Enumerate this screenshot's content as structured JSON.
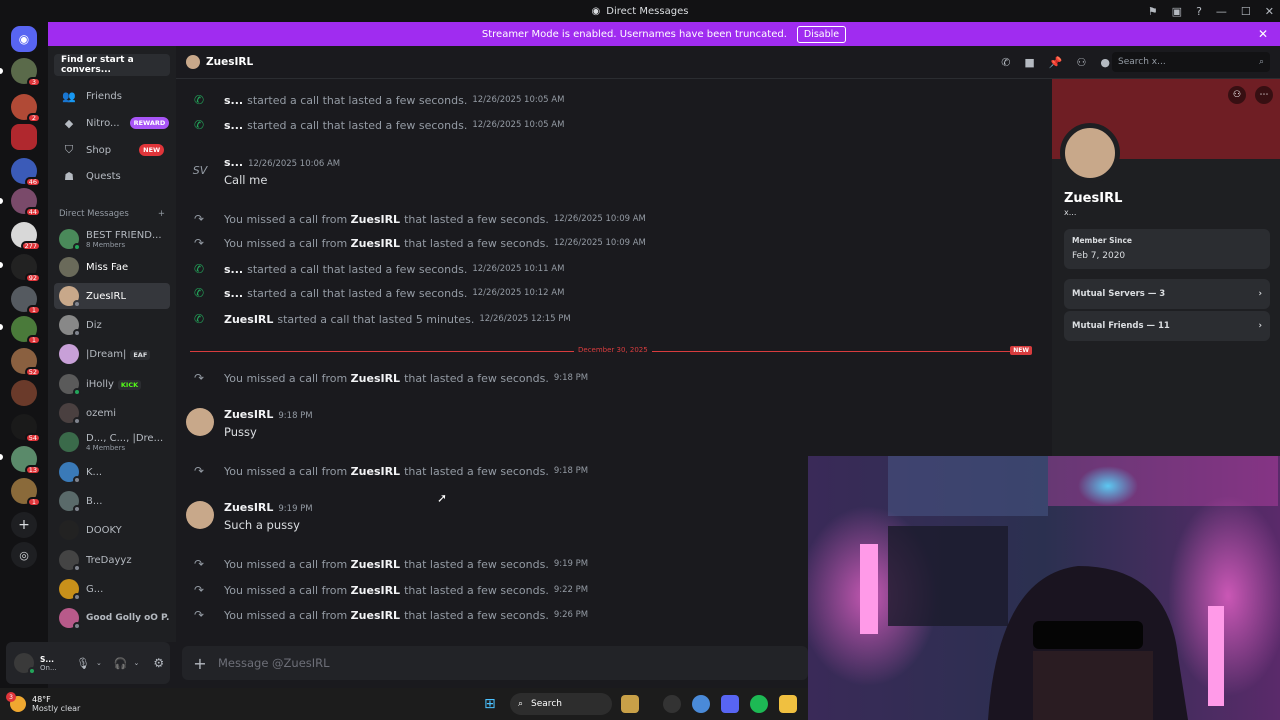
{
  "window": {
    "title": "Direct Messages"
  },
  "banner": {
    "text": "Streamer Mode is enabled. Usernames have been truncated.",
    "button": "Disable"
  },
  "rail": {
    "badges": [
      "3",
      "2",
      "46",
      "44",
      "277",
      "92",
      "1",
      "1",
      "52",
      "54",
      "13",
      "1"
    ]
  },
  "sidebar": {
    "search_placeholder": "Find or start a convers...",
    "nav": [
      {
        "label": "Friends",
        "icon": "friends-icon"
      },
      {
        "label": "Nitro...",
        "icon": "nitro-icon",
        "pill": "REWARD"
      },
      {
        "label": "Shop",
        "icon": "shop-icon",
        "pill": "NEW"
      },
      {
        "label": "Quests",
        "icon": "quests-icon"
      }
    ],
    "dm_header": "Direct Messages",
    "dms": [
      {
        "name": "BEST FRIEND...",
        "sub": "8 Members"
      },
      {
        "name": "Miss Fae"
      },
      {
        "name": "ZuesIRL"
      },
      {
        "name": "Diz"
      },
      {
        "name": "|Dream|",
        "tag": "EAF"
      },
      {
        "name": "iHolly",
        "tag": "KICK"
      },
      {
        "name": "ozemi"
      },
      {
        "name": "D..., C..., |Dre...",
        "sub": "4 Members"
      },
      {
        "name": "K..."
      },
      {
        "name": "B..."
      },
      {
        "name": "DOOKY"
      },
      {
        "name": "TreDayyz"
      },
      {
        "name": "G..."
      },
      {
        "name": "Good Golly oO P..."
      }
    ]
  },
  "user_panel": {
    "name": "S...",
    "status": "On..."
  },
  "chat_header": {
    "name": "ZuesIRL",
    "search_placeholder": "Search x..."
  },
  "messages": {
    "sys1": {
      "name": "s...",
      "text": "started a call that lasted a few seconds.",
      "ts": "12/26/2025 10:05 AM"
    },
    "sys2": {
      "name": "s...",
      "text": "started a call that lasted a few seconds.",
      "ts": "12/26/2025 10:05 AM"
    },
    "msg1": {
      "name": "s...",
      "ts": "12/26/2025 10:06 AM",
      "body": "Call me"
    },
    "sys3": {
      "pre": "You missed a call from",
      "name": "ZuesIRL",
      "text": "that lasted a few seconds.",
      "ts": "12/26/2025 10:09 AM"
    },
    "sys4": {
      "pre": "You missed a call from",
      "name": "ZuesIRL",
      "text": "that lasted a few seconds.",
      "ts": "12/26/2025 10:09 AM"
    },
    "sys5": {
      "name": "s...",
      "text": "started a call that lasted a few seconds.",
      "ts": "12/26/2025 10:11 AM"
    },
    "sys6": {
      "name": "s...",
      "text": "started a call that lasted a few seconds.",
      "ts": "12/26/2025 10:12 AM"
    },
    "sys7": {
      "name": "ZuesIRL",
      "text": "started a call that lasted 5 minutes.",
      "ts": "12/26/2025 12:15 PM"
    },
    "divider": {
      "date": "December 30, 2025",
      "new": "NEW"
    },
    "sys8": {
      "pre": "You missed a call from",
      "name": "ZuesIRL",
      "text": "that lasted a few seconds.",
      "ts": "9:18 PM"
    },
    "msg2": {
      "name": "ZuesIRL",
      "ts": "9:18 PM",
      "body": "Pussy"
    },
    "sys9": {
      "pre": "You missed a call from",
      "name": "ZuesIRL",
      "text": "that lasted a few seconds.",
      "ts": "9:18 PM"
    },
    "msg3": {
      "name": "ZuesIRL",
      "ts": "9:19 PM",
      "body": "Such a pussy"
    },
    "sys10": {
      "pre": "You missed a call from",
      "name": "ZuesIRL",
      "text": "that lasted a few seconds.",
      "ts": "9:19 PM"
    },
    "sys11": {
      "pre": "You missed a call from",
      "name": "ZuesIRL",
      "text": "that lasted a few seconds.",
      "ts": "9:22 PM"
    },
    "sys12": {
      "pre": "You missed a call from",
      "name": "ZuesIRL",
      "text": "that lasted a few seconds.",
      "ts": "9:26 PM"
    }
  },
  "composer": {
    "placeholder": "Message @ZuesIRL"
  },
  "profile": {
    "name": "ZuesIRL",
    "sub": "x...",
    "member_since_label": "Member Since",
    "member_since": "Feb 7, 2020",
    "mutual_servers": "Mutual Servers — 3",
    "mutual_friends": "Mutual Friends — 11"
  },
  "taskbar": {
    "temp": "48°F",
    "weather": "Mostly clear",
    "search": "Search",
    "weather_badge": "3"
  },
  "colors": {
    "accent": "#a02cf0",
    "call_green": "#23a55a",
    "danger": "#d83c3e"
  }
}
